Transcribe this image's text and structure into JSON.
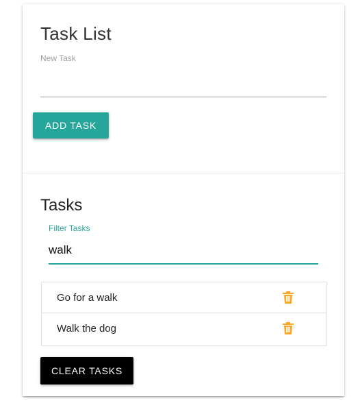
{
  "colors": {
    "accent": "#26a69a",
    "delete_icon": "#f9a825",
    "clear_button": "#000000"
  },
  "task_form": {
    "title": "Task List",
    "new_task_label": "New Task",
    "new_task_value": "",
    "add_button_label": "ADD TASK"
  },
  "tasks_section": {
    "title": "Tasks",
    "filter_label": "Filter Tasks",
    "filter_value": "walk",
    "items": [
      {
        "text": "Go for a walk",
        "icon": "trash-icon"
      },
      {
        "text": "Walk the dog",
        "icon": "trash-icon"
      }
    ],
    "clear_button_label": "CLEAR TASKS"
  }
}
